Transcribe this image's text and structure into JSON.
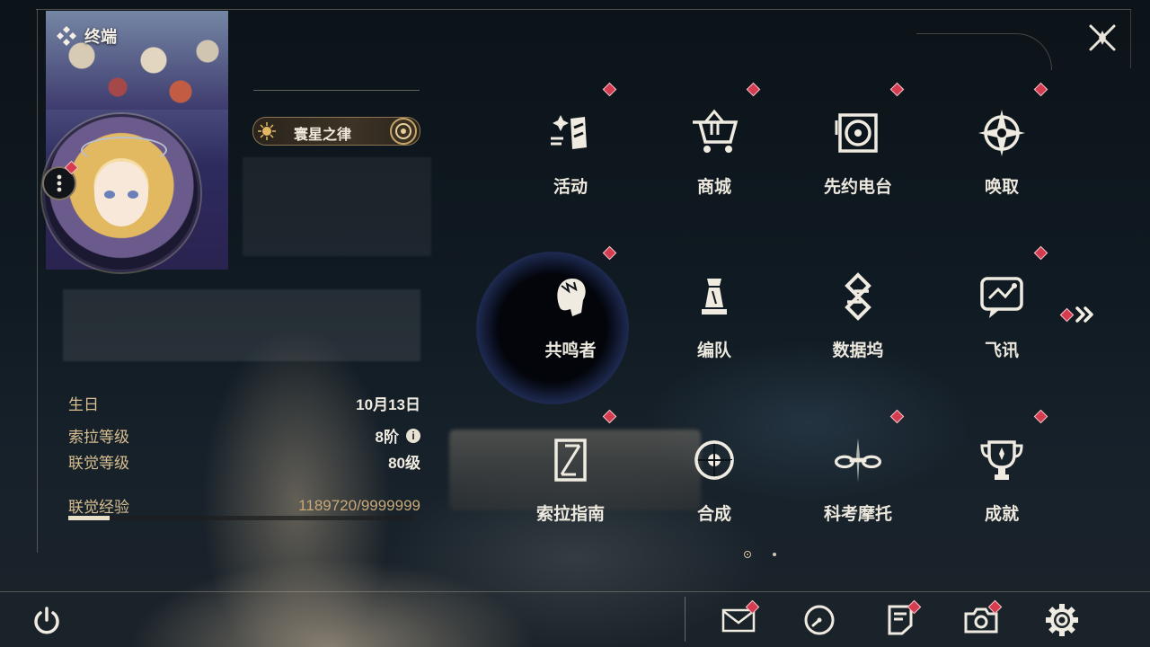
{
  "header": {
    "terminal_label": "终端"
  },
  "profile": {
    "title_badge": "寰星之律",
    "stats": [
      {
        "key": "生日",
        "value": "10月13日"
      },
      {
        "key": "索拉等级",
        "value": "8阶"
      },
      {
        "key": "联觉等级",
        "value": "80级"
      }
    ],
    "xp": {
      "label": "联觉经验",
      "value": "1189720/9999999",
      "fraction": 0.119
    }
  },
  "menu": {
    "items": [
      {
        "label": "活动",
        "icon": "activity-icon",
        "badge": true
      },
      {
        "label": "商城",
        "icon": "shop-cart-icon",
        "badge": true
      },
      {
        "label": "先约电台",
        "icon": "radio-icon",
        "badge": true
      },
      {
        "label": "唤取",
        "icon": "convene-compass-icon",
        "badge": true
      },
      {
        "label": "共鸣者",
        "icon": "resonator-head-icon",
        "badge": true
      },
      {
        "label": "编队",
        "icon": "chess-team-icon",
        "badge": false
      },
      {
        "label": "数据坞",
        "icon": "data-bank-icon",
        "badge": false
      },
      {
        "label": "飞讯",
        "icon": "messenger-icon",
        "badge": true
      },
      {
        "label": "索拉指南",
        "icon": "guidebook-icon",
        "badge": true
      },
      {
        "label": "合成",
        "icon": "synthesis-icon",
        "badge": false
      },
      {
        "label": "科考摩托",
        "icon": "motorcycle-icon",
        "badge": true
      },
      {
        "label": "成就",
        "icon": "trophy-icon",
        "badge": true
      }
    ],
    "page": 1,
    "page_count": 2
  },
  "bottom_bar": [
    {
      "name": "mail",
      "icon": "mail-icon",
      "badge": true
    },
    {
      "name": "events",
      "icon": "clock-icon",
      "badge": false
    },
    {
      "name": "notices",
      "icon": "notice-icon",
      "badge": true
    },
    {
      "name": "photo",
      "icon": "camera-icon",
      "badge": true
    },
    {
      "name": "settings",
      "icon": "gear-icon",
      "badge": false
    }
  ],
  "colors": {
    "accent_gold": "#d8bf92",
    "badge_red": "#d63c4f",
    "text_light": "#ece8de"
  }
}
